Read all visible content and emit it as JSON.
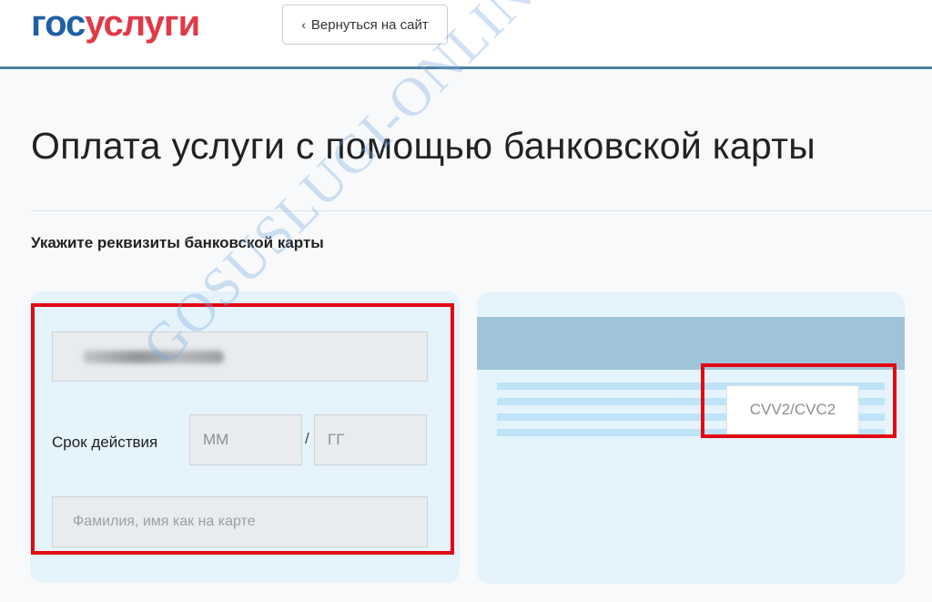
{
  "header": {
    "logo_part1": "гос",
    "logo_part2": "услуги",
    "back_label": "Вернуться на сайт"
  },
  "main": {
    "title": "Оплата услуги с помощью банковской карты",
    "section_label": "Укажите реквизиты банковской карты"
  },
  "form": {
    "card_number_value": "",
    "expiry_label": "Срок действия",
    "month_placeholder": "ММ",
    "separator": "/",
    "year_placeholder": "ГГ",
    "name_placeholder": "Фамилия, имя как на карте",
    "cvv_placeholder": "CVV2/CVC2"
  },
  "watermark": "GOSUSLUGI-ONLINE.RU",
  "colors": {
    "logo_blue": "#1f5fa5",
    "logo_red": "#e03a47",
    "highlight": "#e30613",
    "card_bg": "#e4f3fc",
    "stripe": "#9fc4d9",
    "header_border": "#4a7fa0"
  }
}
